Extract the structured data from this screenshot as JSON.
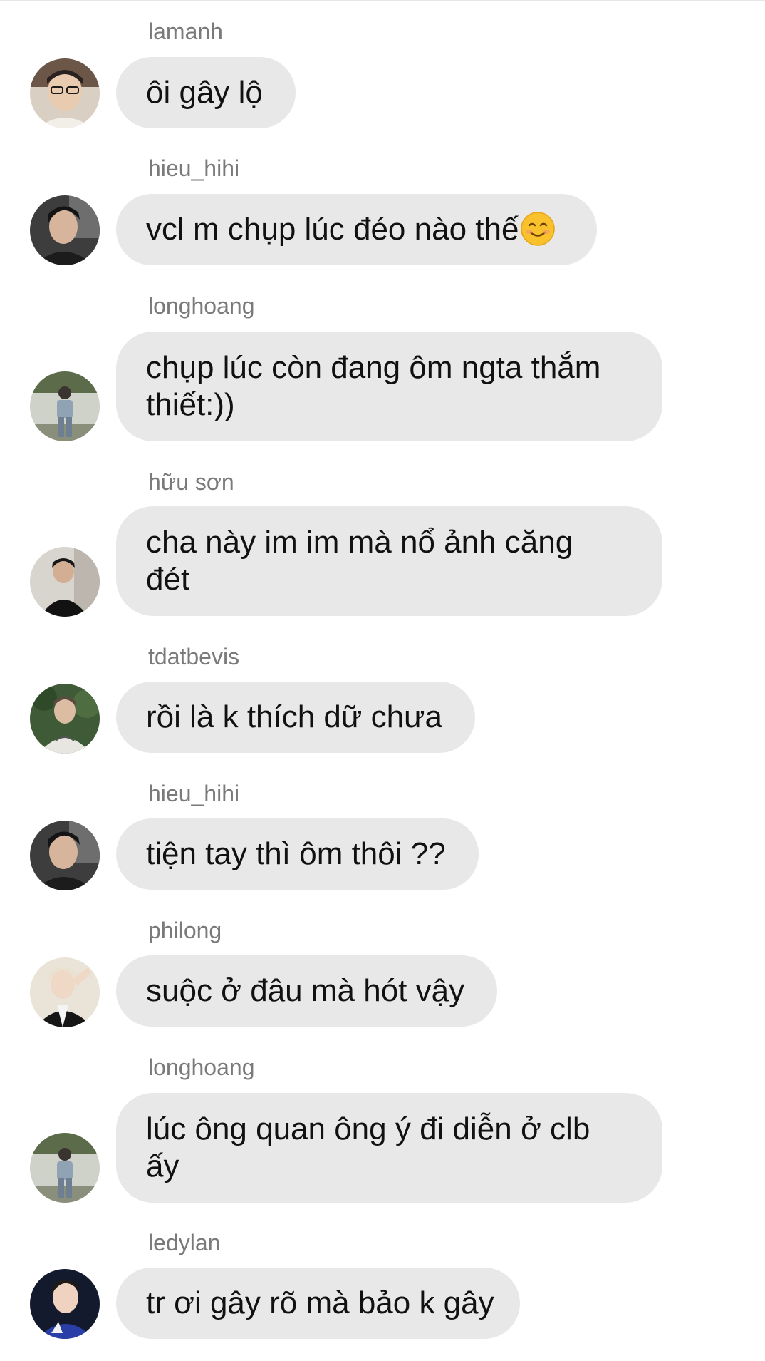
{
  "messages": [
    {
      "sender": "lamanh",
      "text": "ôi gây lộ",
      "avatar": "avatar-photo"
    },
    {
      "sender": "hieu_hihi",
      "text": "vcl m chụp lúc đéo nào thế",
      "emoji": "smiling-face-emoji",
      "avatar": "avatar-photo"
    },
    {
      "sender": "longhoang",
      "text": "chụp lúc còn đang ôm ngta thắm\nthiết:))",
      "avatar": "avatar-photo"
    },
    {
      "sender": "hữu sơn",
      "text": "cha này im im mà nổ ảnh căng\nđét",
      "avatar": "avatar-photo"
    },
    {
      "sender": "tdatbevis",
      "text": "rồi là k thích dữ chưa",
      "avatar": "avatar-photo"
    },
    {
      "sender": "hieu_hihi",
      "text": "tiện tay thì ôm thôi ??",
      "avatar": "avatar-photo"
    },
    {
      "sender": "philong",
      "text": "suộc ở đâu mà hót vậy",
      "avatar": "avatar-photo"
    },
    {
      "sender": "longhoang",
      "text": "lúc ông quan ông ý đi diễn ở clb\nấy",
      "avatar": "avatar-photo"
    },
    {
      "sender": "ledylan",
      "text": "tr ơi gây rõ mà bảo k gây",
      "avatar": "avatar-photo"
    }
  ],
  "colors": {
    "bubble": "#e8e8e8",
    "sender_text": "#7a7a7a",
    "message_text": "#111111",
    "background": "#ffffff"
  }
}
